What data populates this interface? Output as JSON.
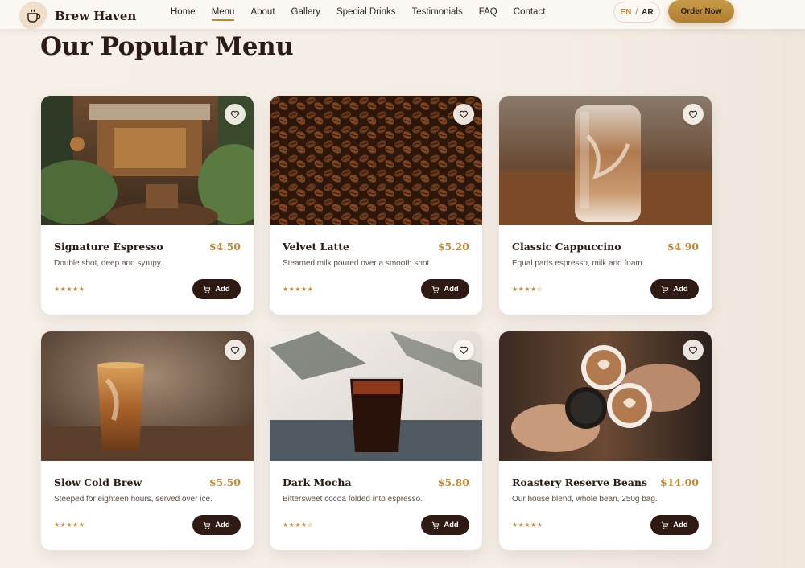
{
  "brand": {
    "name": "Brew Haven"
  },
  "nav": {
    "items": [
      {
        "label": "Home"
      },
      {
        "label": "Menu"
      },
      {
        "label": "About"
      },
      {
        "label": "Gallery"
      },
      {
        "label": "Special Drinks"
      },
      {
        "label": "Testimonials"
      },
      {
        "label": "FAQ"
      },
      {
        "label": "Contact"
      }
    ],
    "active": "Menu"
  },
  "lang": {
    "en": "EN",
    "sep": "/",
    "ar": "AR"
  },
  "header": {
    "order_label": "Order Now"
  },
  "main": {
    "title": "Our Popular Menu"
  },
  "colors": {
    "accent": "#c08a35",
    "dark": "#2e1a12",
    "background": "#f5eee6"
  },
  "menu": {
    "items": [
      {
        "name": "Signature Espresso",
        "price": "$4.50",
        "description": "Double shot, deep and syrupy.",
        "rating": "★★★★★",
        "add_label": "Add",
        "image": "cafe-interior"
      },
      {
        "name": "Velvet Latte",
        "price": "$5.20",
        "description": "Steamed milk poured over a smooth shot.",
        "rating": "★★★★★",
        "add_label": "Add",
        "image": "coffee-beans"
      },
      {
        "name": "Classic Cappuccino",
        "price": "$4.90",
        "description": "Equal parts espresso, milk and foam.",
        "rating": "★★★★☆",
        "add_label": "Add",
        "image": "iced-latte-jar"
      },
      {
        "name": "Slow Cold Brew",
        "price": "$5.50",
        "description": "Steeped for eighteen hours, served over ice.",
        "rating": "★★★★★",
        "add_label": "Add",
        "image": "iced-coffee-glass"
      },
      {
        "name": "Dark Mocha",
        "price": "$5.80",
        "description": "Bittersweet cocoa folded into espresso.",
        "rating": "★★★★☆",
        "add_label": "Add",
        "image": "dark-iced-drink"
      },
      {
        "name": "Roastery Reserve Beans",
        "price": "$14.00",
        "description": "Our house blend, whole bean, 250g bag.",
        "rating": "★★★★★",
        "add_label": "Add",
        "image": "latte-art-cheers"
      }
    ]
  },
  "icons": {
    "favorite": "heart-icon",
    "cart": "cart-icon",
    "logo": "cup-icon"
  }
}
